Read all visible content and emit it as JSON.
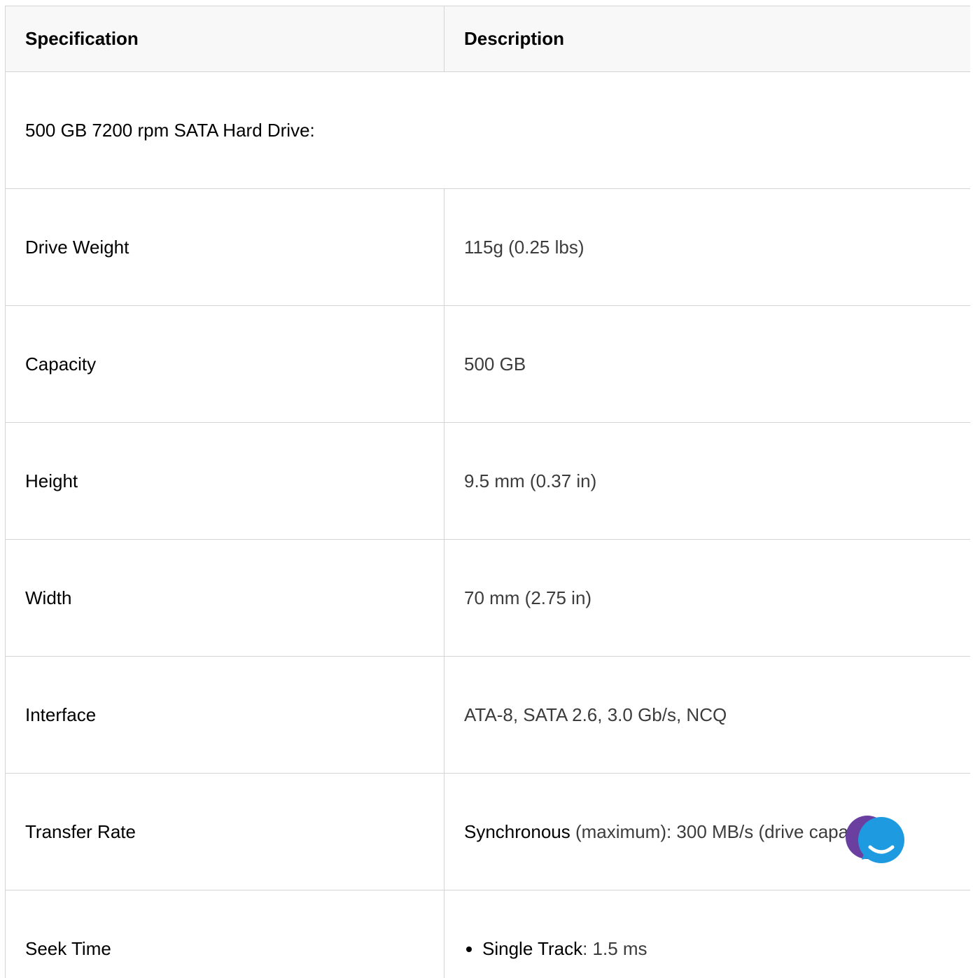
{
  "table": {
    "headers": {
      "spec": "Specification",
      "desc": "Description"
    },
    "section_title": "500 GB 7200 rpm SATA Hard Drive:",
    "rows": [
      {
        "name": "Drive Weight",
        "value": "115g (0.25 lbs)"
      },
      {
        "name": "Capacity",
        "value": "500 GB"
      },
      {
        "name": "Height",
        "value": "9.5 mm (0.37 in)"
      },
      {
        "name": "Width",
        "value": "70 mm (2.75 in)"
      },
      {
        "name": "Interface",
        "value": "ATA-8, SATA 2.6, 3.0 Gb/s, NCQ"
      }
    ],
    "transfer": {
      "name": "Transfer Rate",
      "label": "Synchronous",
      "value": " (maximum): 300 MB/s (drive capabi"
    },
    "seek": {
      "name": "Seek Time",
      "items": [
        {
          "label": "Single Track",
          "value": ": 1.5 ms"
        }
      ]
    }
  },
  "chat_widget": {
    "icon": "chat-bubble-icon",
    "colors": {
      "back": "#6b3fa0",
      "front": "#1e9be0"
    }
  }
}
